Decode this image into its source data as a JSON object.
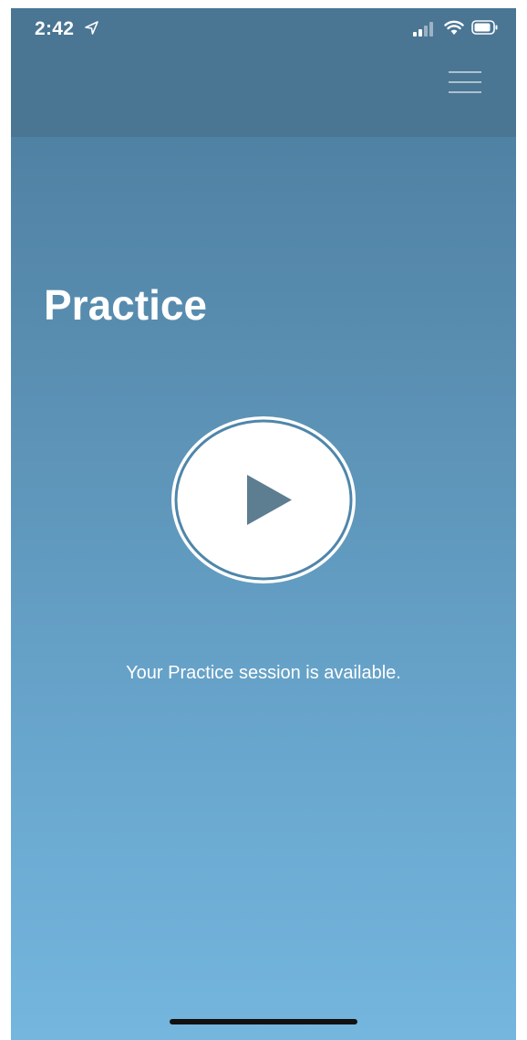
{
  "status_bar": {
    "time": "2:42",
    "location_icon": "location-arrow-icon",
    "signal_icon": "cellular-signal-icon",
    "wifi_icon": "wifi-icon",
    "battery_icon": "battery-icon"
  },
  "header": {
    "menu_icon": "hamburger-menu-icon"
  },
  "main": {
    "title": "Practice",
    "play_icon": "play-icon",
    "session_message": "Your Practice session is available."
  },
  "colors": {
    "header_background": "#4a7694",
    "gradient_top": "#4a7a9c",
    "gradient_bottom": "#74b6de",
    "play_triangle": "#5d7d91",
    "text": "#ffffff"
  }
}
